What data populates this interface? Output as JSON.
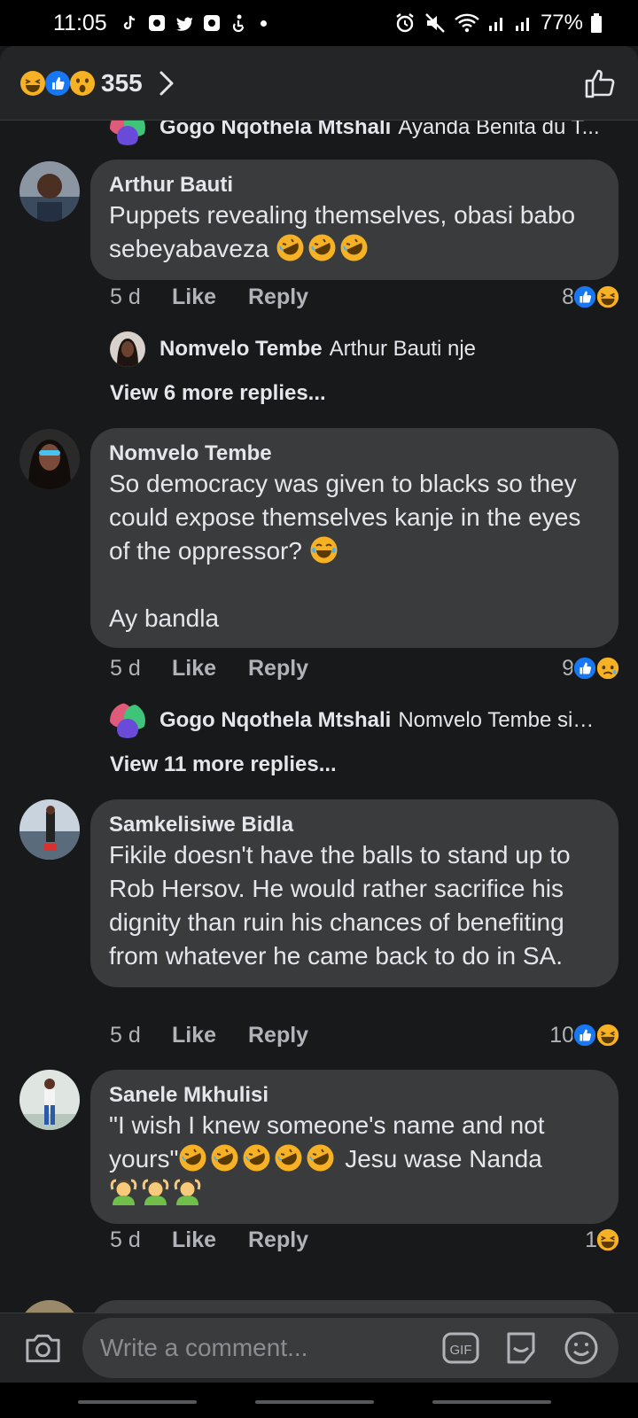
{
  "status_bar": {
    "time": "11:05",
    "battery": "77%"
  },
  "reactions_header": {
    "count": "355",
    "icons": [
      "haha-icon",
      "like-icon",
      "wow-icon"
    ]
  },
  "comments": [
    {
      "author": "Arthur Bauti",
      "text": "Puppets revealing themselves, obasi babo sebeyabaveza",
      "time": "5 d",
      "like_label": "Like",
      "reply_label": "Reply",
      "reaction_count": "8",
      "reply_preview": {
        "author": "Nomvelo Tembe",
        "text": "Arthur Bauti nje"
      },
      "more_replies": "View 6 more replies..."
    },
    {
      "author": "Nomvelo Tembe",
      "text_line1": "So democracy was given to blacks so they could expose themselves kanje in the eyes of the oppressor?",
      "text_line2": "Ay bandla",
      "time": "5 d",
      "like_label": "Like",
      "reply_label": "Reply",
      "reaction_count": "9",
      "reply_preview": {
        "author": "Gogo Nqothela Mtshali",
        "text": "Nomvelo Tembe si…"
      },
      "more_replies": "View 11 more replies..."
    },
    {
      "author": "Samkelisiwe Bidla",
      "text": "Fikile doesn't have the balls to stand up to Rob Hersov. He would rather sacrifice his dignity than ruin his chances of benefiting from whatever he came back to do in SA.",
      "time": "5 d",
      "like_label": "Like",
      "reply_label": "Reply",
      "reaction_count": "10"
    },
    {
      "author": "Sanele Mkhulisi",
      "text_a": "\"I wish I knew someone's name and not yours\"",
      "text_b": " Jesu wase Nanda",
      "time": "5 d",
      "like_label": "Like",
      "reply_label": "Reply",
      "reaction_count": "1"
    }
  ],
  "top_partial_reply": {
    "author": "Gogo Nqothela Mtshali",
    "text": "Ayanda Benita du T..."
  },
  "composer": {
    "placeholder": "Write a comment..."
  },
  "colors": {
    "background": "#18191a",
    "bubble": "#3a3b3c",
    "like_blue": "#1877f2",
    "haha_yellow": "#f7b125"
  }
}
